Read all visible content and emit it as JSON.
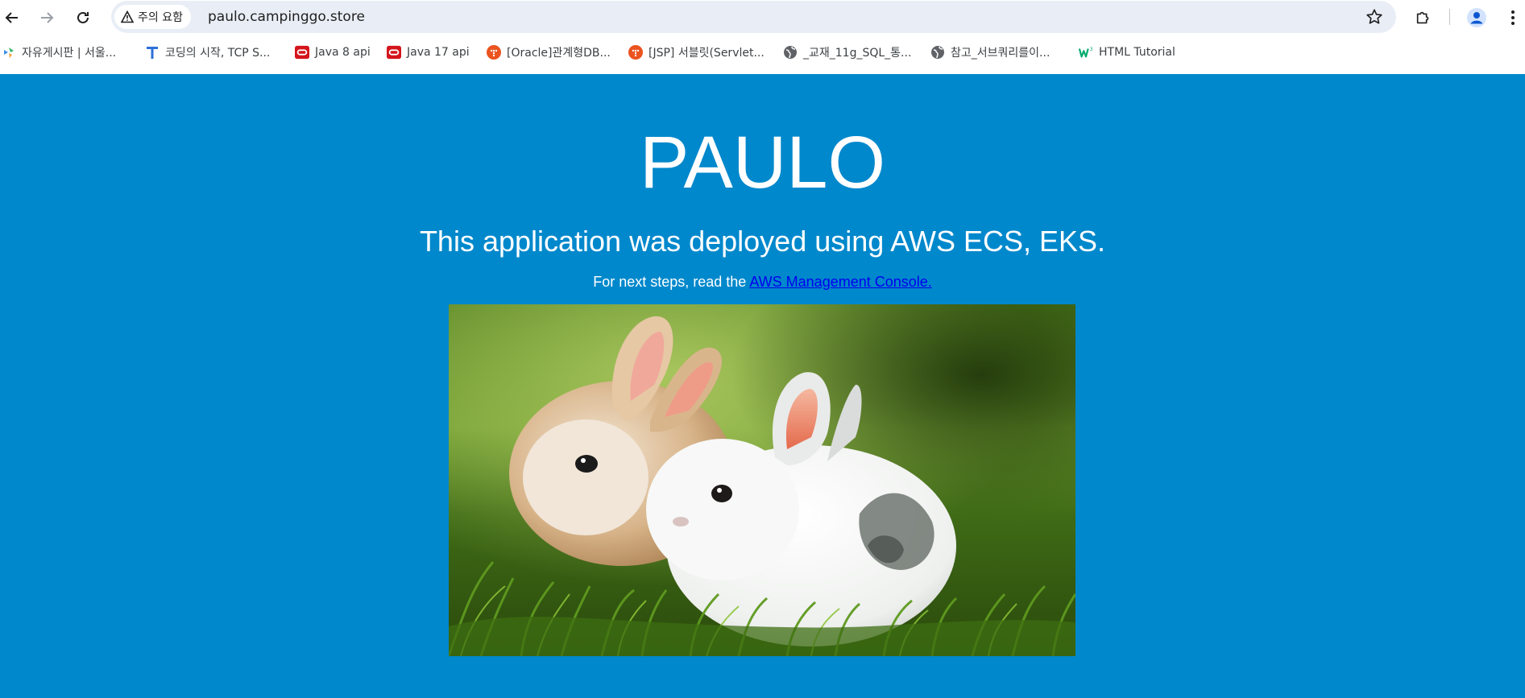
{
  "browser": {
    "security_chip": "주의 요함",
    "url": "paulo.campinggo.store"
  },
  "bookmarks": [
    {
      "label": "자유게시판 | 서울...",
      "icon": "colorful-logo-icon"
    },
    {
      "label": "코딩의 시작, TCP S...",
      "icon": "tcp-school-t-icon"
    },
    {
      "label": "Java 8 api",
      "icon": "oracle-icon"
    },
    {
      "label": "Java 17 api",
      "icon": "oracle-icon"
    },
    {
      "label": "[Oracle]관계형DB...",
      "icon": "tistory-icon"
    },
    {
      "label": "[JSP] 서블릿(Servlet...",
      "icon": "tistory-icon"
    },
    {
      "label": "_교재_11g_SQL_통...",
      "icon": "globe-icon"
    },
    {
      "label": "참고_서브쿼리를이...",
      "icon": "globe-icon"
    },
    {
      "label": "HTML Tutorial",
      "icon": "w3schools-icon"
    }
  ],
  "page": {
    "title": "PAULO",
    "subtitle": "This application was deployed using AWS ECS, EKS.",
    "next_steps_text": "For next steps, read the ",
    "link_text": "AWS Management Console."
  },
  "colors": {
    "page_background": "#0088cc",
    "link": "#0000ee",
    "browser_chrome": "#ffffff",
    "omnibox": "#e9eef6"
  }
}
